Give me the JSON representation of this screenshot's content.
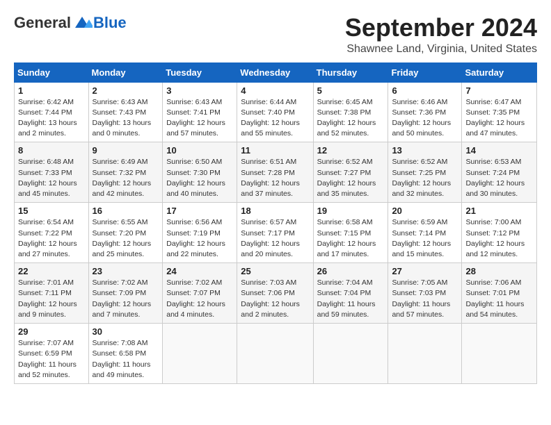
{
  "header": {
    "logo_general": "General",
    "logo_blue": "Blue",
    "month_title": "September 2024",
    "location": "Shawnee Land, Virginia, United States"
  },
  "calendar": {
    "days_of_week": [
      "Sunday",
      "Monday",
      "Tuesday",
      "Wednesday",
      "Thursday",
      "Friday",
      "Saturday"
    ],
    "weeks": [
      [
        {
          "day": "1",
          "sunrise": "6:42 AM",
          "sunset": "7:44 PM",
          "daylight": "13 hours and 2 minutes."
        },
        {
          "day": "2",
          "sunrise": "6:43 AM",
          "sunset": "7:43 PM",
          "daylight": "13 hours and 0 minutes."
        },
        {
          "day": "3",
          "sunrise": "6:43 AM",
          "sunset": "7:41 PM",
          "daylight": "12 hours and 57 minutes."
        },
        {
          "day": "4",
          "sunrise": "6:44 AM",
          "sunset": "7:40 PM",
          "daylight": "12 hours and 55 minutes."
        },
        {
          "day": "5",
          "sunrise": "6:45 AM",
          "sunset": "7:38 PM",
          "daylight": "12 hours and 52 minutes."
        },
        {
          "day": "6",
          "sunrise": "6:46 AM",
          "sunset": "7:36 PM",
          "daylight": "12 hours and 50 minutes."
        },
        {
          "day": "7",
          "sunrise": "6:47 AM",
          "sunset": "7:35 PM",
          "daylight": "12 hours and 47 minutes."
        }
      ],
      [
        {
          "day": "8",
          "sunrise": "6:48 AM",
          "sunset": "7:33 PM",
          "daylight": "12 hours and 45 minutes."
        },
        {
          "day": "9",
          "sunrise": "6:49 AM",
          "sunset": "7:32 PM",
          "daylight": "12 hours and 42 minutes."
        },
        {
          "day": "10",
          "sunrise": "6:50 AM",
          "sunset": "7:30 PM",
          "daylight": "12 hours and 40 minutes."
        },
        {
          "day": "11",
          "sunrise": "6:51 AM",
          "sunset": "7:28 PM",
          "daylight": "12 hours and 37 minutes."
        },
        {
          "day": "12",
          "sunrise": "6:52 AM",
          "sunset": "7:27 PM",
          "daylight": "12 hours and 35 minutes."
        },
        {
          "day": "13",
          "sunrise": "6:52 AM",
          "sunset": "7:25 PM",
          "daylight": "12 hours and 32 minutes."
        },
        {
          "day": "14",
          "sunrise": "6:53 AM",
          "sunset": "7:24 PM",
          "daylight": "12 hours and 30 minutes."
        }
      ],
      [
        {
          "day": "15",
          "sunrise": "6:54 AM",
          "sunset": "7:22 PM",
          "daylight": "12 hours and 27 minutes."
        },
        {
          "day": "16",
          "sunrise": "6:55 AM",
          "sunset": "7:20 PM",
          "daylight": "12 hours and 25 minutes."
        },
        {
          "day": "17",
          "sunrise": "6:56 AM",
          "sunset": "7:19 PM",
          "daylight": "12 hours and 22 minutes."
        },
        {
          "day": "18",
          "sunrise": "6:57 AM",
          "sunset": "7:17 PM",
          "daylight": "12 hours and 20 minutes."
        },
        {
          "day": "19",
          "sunrise": "6:58 AM",
          "sunset": "7:15 PM",
          "daylight": "12 hours and 17 minutes."
        },
        {
          "day": "20",
          "sunrise": "6:59 AM",
          "sunset": "7:14 PM",
          "daylight": "12 hours and 15 minutes."
        },
        {
          "day": "21",
          "sunrise": "7:00 AM",
          "sunset": "7:12 PM",
          "daylight": "12 hours and 12 minutes."
        }
      ],
      [
        {
          "day": "22",
          "sunrise": "7:01 AM",
          "sunset": "7:11 PM",
          "daylight": "12 hours and 9 minutes."
        },
        {
          "day": "23",
          "sunrise": "7:02 AM",
          "sunset": "7:09 PM",
          "daylight": "12 hours and 7 minutes."
        },
        {
          "day": "24",
          "sunrise": "7:02 AM",
          "sunset": "7:07 PM",
          "daylight": "12 hours and 4 minutes."
        },
        {
          "day": "25",
          "sunrise": "7:03 AM",
          "sunset": "7:06 PM",
          "daylight": "12 hours and 2 minutes."
        },
        {
          "day": "26",
          "sunrise": "7:04 AM",
          "sunset": "7:04 PM",
          "daylight": "11 hours and 59 minutes."
        },
        {
          "day": "27",
          "sunrise": "7:05 AM",
          "sunset": "7:03 PM",
          "daylight": "11 hours and 57 minutes."
        },
        {
          "day": "28",
          "sunrise": "7:06 AM",
          "sunset": "7:01 PM",
          "daylight": "11 hours and 54 minutes."
        }
      ],
      [
        {
          "day": "29",
          "sunrise": "7:07 AM",
          "sunset": "6:59 PM",
          "daylight": "11 hours and 52 minutes."
        },
        {
          "day": "30",
          "sunrise": "7:08 AM",
          "sunset": "6:58 PM",
          "daylight": "11 hours and 49 minutes."
        },
        null,
        null,
        null,
        null,
        null
      ]
    ]
  }
}
